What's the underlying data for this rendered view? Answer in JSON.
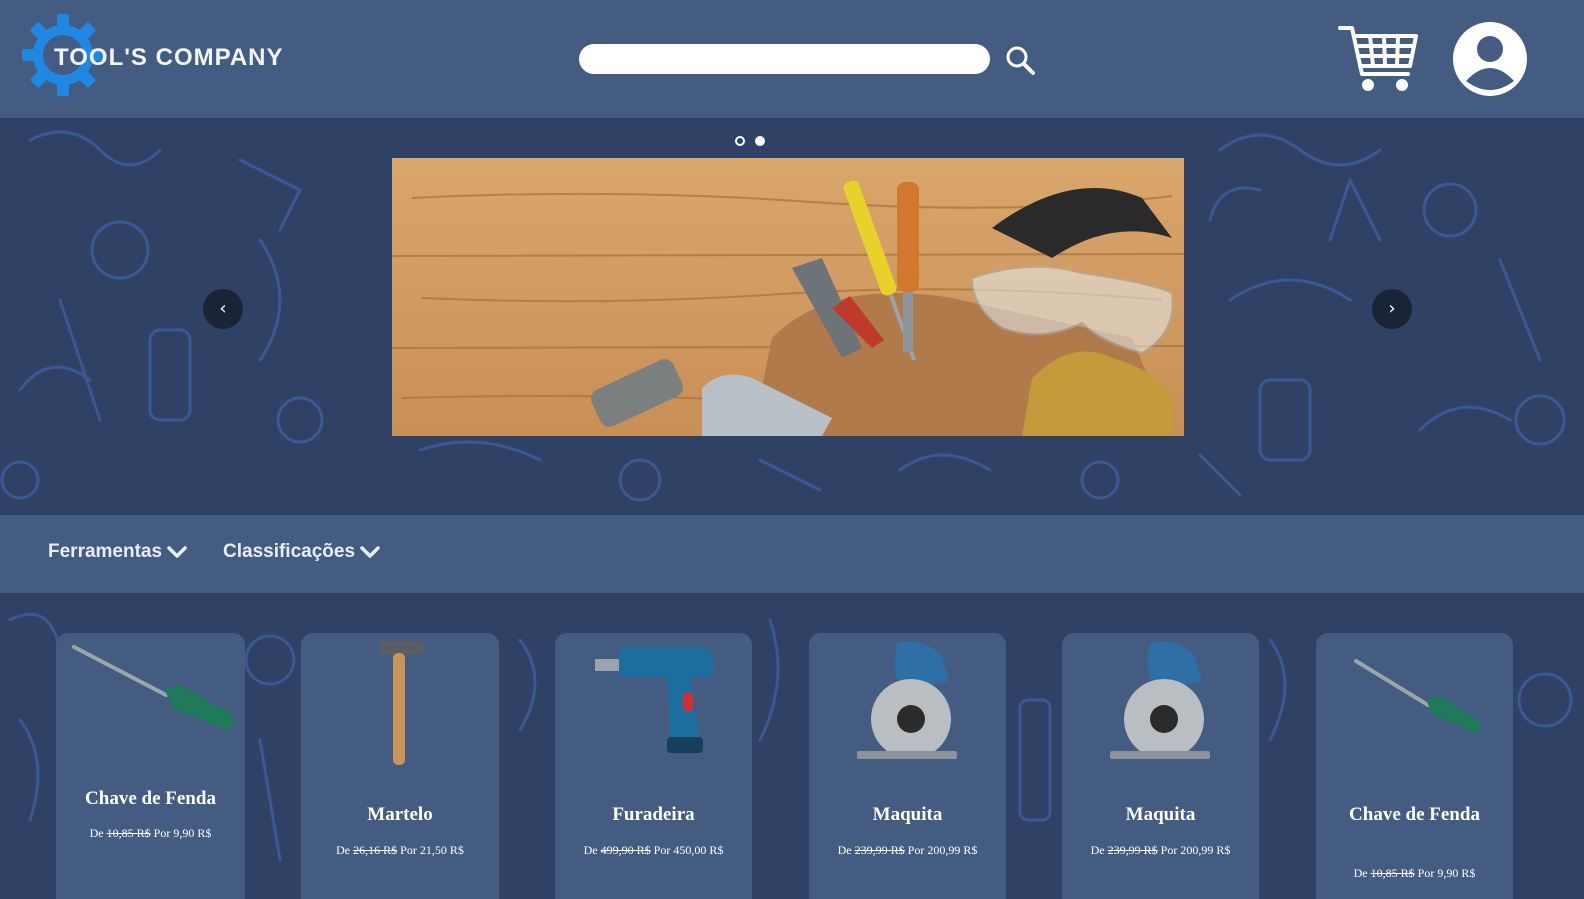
{
  "brand": {
    "name": "TOOL'S COMPANY",
    "accent": "#1e88e5"
  },
  "colors": {
    "header": "#445c82",
    "background": "#2f4266",
    "pattern": "#3d5c99"
  },
  "search": {
    "placeholder": "",
    "value": ""
  },
  "carousel": {
    "slide_count": 2,
    "active_index": 1,
    "prev": "‹",
    "next": "›"
  },
  "nav": {
    "items": [
      {
        "label": "Ferramentas"
      },
      {
        "label": "Classificações"
      }
    ]
  },
  "products": [
    {
      "name": "Chave de Fenda",
      "from_label": "De",
      "old_price": "10,85 R$",
      "to_label": "Por",
      "price": "9,90 R$",
      "icon": "screwdriver-image"
    },
    {
      "name": "Martelo",
      "from_label": "De",
      "old_price": "26,16 R$",
      "to_label": "Por",
      "price": "21,50 R$",
      "icon": "hammer-image"
    },
    {
      "name": "Furadeira",
      "from_label": "De",
      "old_price": "499,90 R$",
      "to_label": "Por",
      "price": "450,00 R$",
      "icon": "drill-image"
    },
    {
      "name": "Maquita",
      "from_label": "De",
      "old_price": "239,99 R$",
      "to_label": "Por",
      "price": "200,99 R$",
      "icon": "circular-saw-image"
    },
    {
      "name": "Maquita",
      "from_label": "De",
      "old_price": "239,99 R$",
      "to_label": "Por",
      "price": "200,99 R$",
      "icon": "circular-saw-image"
    },
    {
      "name": "Chave de Fenda",
      "from_label": "De",
      "old_price": "10,85 R$",
      "to_label": "Por",
      "price": "9,90 R$",
      "icon": "screwdriver-image"
    }
  ]
}
